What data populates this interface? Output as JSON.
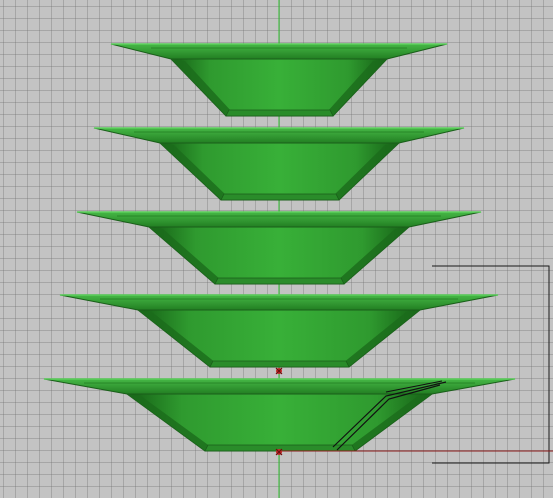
{
  "viewport": {
    "view": "3D viewport",
    "background_color": "#c3c3c3",
    "grid_color": "#8c8c8c",
    "axis_color": "#2fbf2f"
  },
  "model": {
    "object_type": "stacked dishes",
    "dish_count": 5,
    "fill_color": "#2e9a2e",
    "rim_color": "#3aa83a",
    "edge_color": "#1a5e1a",
    "selected_curve_color": "#000000",
    "origin_marker_color": "#c62828"
  }
}
